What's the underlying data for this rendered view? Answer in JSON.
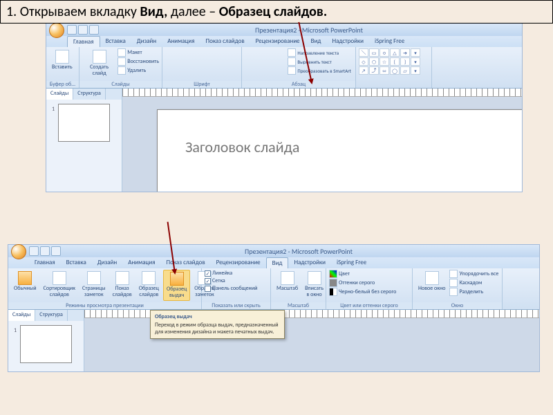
{
  "instruction": {
    "prefix": "1. Открываем вкладку ",
    "bold1": "Вид,",
    "middle": " далее – ",
    "bold2": "Образец слайдов."
  },
  "app_title": "Презентация2 - Microsoft PowerPoint",
  "tabs": {
    "home": "Главная",
    "insert": "Вставка",
    "design": "Дизайн",
    "animation": "Анимация",
    "slideshow": "Показ слайдов",
    "review": "Рецензирование",
    "view": "Вид",
    "addins": "Надстройки",
    "ispring": "iSpring Free"
  },
  "home_ribbon": {
    "paste": "Вставить",
    "new_slide": "Создать слайд",
    "layout": "Макет",
    "reset": "Восстановить",
    "delete": "Удалить",
    "clipboard": "Буфер об...",
    "slides": "Слайды",
    "font": "Шрифт",
    "paragraph": "Абзац",
    "text_direction": "Направление текста",
    "align_text": "Выровнить текст",
    "convert_smartart": "Преобразовать в SmartArt"
  },
  "view_ribbon": {
    "normal": "Обычный",
    "sorter": "Сортировщик слайдов",
    "notes": "Страницы заметок",
    "slideshow": "Показ слайдов",
    "slide_master": "Образец слайдов",
    "handout_master": "Образец выдач",
    "notes_master": "Образец заметок",
    "modes": "Режимы просмотра презентации",
    "ruler": "Линейка",
    "gridlines": "Сетка",
    "message_bar": "Панель сообщений",
    "show_hide": "Показать или скрыть",
    "zoom": "Масштаб",
    "fit": "Вписать в окно",
    "zoom_group": "Масштаб",
    "color": "Цвет",
    "grayscale": "Оттенки серого",
    "bw": "Черно-белый без серого",
    "color_group": "Цвет или оттенки серого",
    "new_window": "Новое окно",
    "arrange_all": "Упорядочить все",
    "cascade": "Каскадом",
    "split": "Разделить",
    "window": "Окно"
  },
  "side": {
    "slides": "Слайды",
    "outline": "Структура"
  },
  "slide": {
    "title_placeholder": "Заголовок слайда"
  },
  "tooltip": {
    "title": "Образец выдач",
    "body": "Переход в режим образца выдач, предназначенный для изменения дизайна и макета печатных выдач."
  }
}
